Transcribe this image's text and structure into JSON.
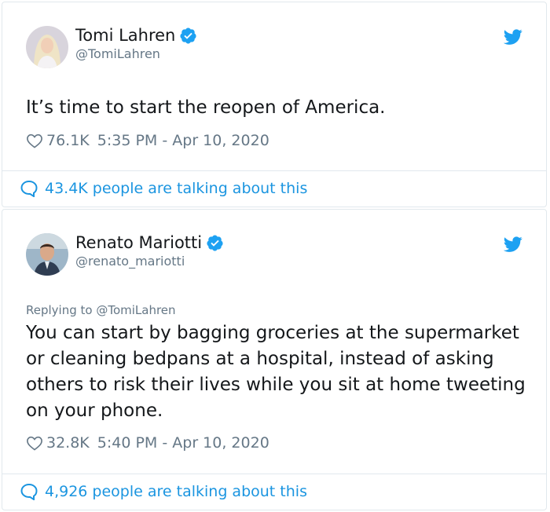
{
  "tweets": [
    {
      "display_name": "Tomi Lahren",
      "handle": "@TomiLahren",
      "replying_to": "",
      "text": "It’s time to start the reopen of America.",
      "likes": "76.1K",
      "timestamp": "5:35 PM - Apr 10, 2020",
      "talking": "43.4K people are talking about this",
      "verified_icon": "verified-badge-icon",
      "source_icon": "twitter-bird-icon"
    },
    {
      "display_name": "Renato Mariotti",
      "handle": "@renato_mariotti",
      "replying_to": "Replying to @TomiLahren",
      "text": "You can start by bagging groceries at the supermarket or cleaning bedpans at a hospital, instead of asking others to risk their lives while you sit at home tweeting on your phone.",
      "likes": "32.8K",
      "timestamp": "5:40 PM - Apr 10, 2020",
      "talking": "4,926 people are talking about this",
      "verified_icon": "verified-badge-icon",
      "source_icon": "twitter-bird-icon"
    }
  ],
  "colors": {
    "text": "#14171a",
    "muted": "#657786",
    "link": "#1b95e0",
    "twitter_blue": "#1da1f2",
    "border": "#e1e8ed"
  }
}
